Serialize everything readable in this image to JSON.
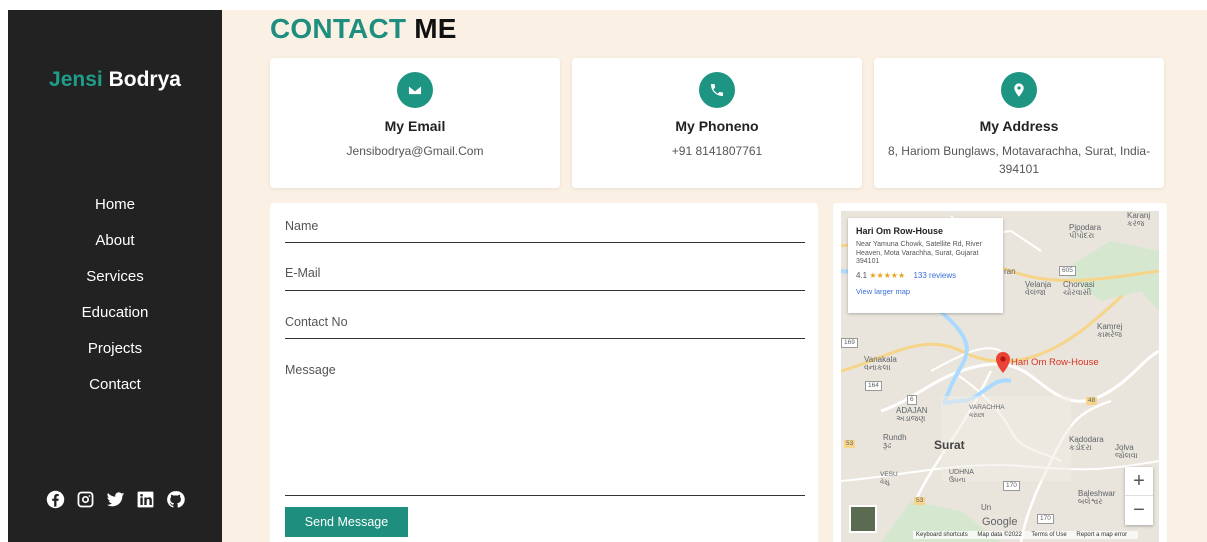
{
  "sidebar": {
    "brand_first": "Jensi",
    "brand_last": "Bodrya",
    "nav": [
      "Home",
      "About",
      "Services",
      "Education",
      "Projects",
      "Contact"
    ],
    "social_icons": [
      "facebook-icon",
      "instagram-icon",
      "twitter-icon",
      "linkedin-icon",
      "github-icon"
    ]
  },
  "main": {
    "title_a": "CONTACT",
    "title_b": "ME",
    "cards": [
      {
        "title": "My Email",
        "value": "Jensibodrya@Gmail.Com",
        "icon": "envelope-icon"
      },
      {
        "title": "My Phoneno",
        "value": "+91 8141807761",
        "icon": "phone-icon"
      },
      {
        "title": "My Address",
        "value": "8, Hariom Bunglaws, Motavarachha, Surat, India-394101",
        "icon": "map-marker-icon"
      }
    ],
    "form": {
      "name_placeholder": "Name",
      "email_placeholder": "E-Mail",
      "contact_placeholder": "Contact No",
      "message_placeholder": "Message",
      "submit_label": "Send Message"
    },
    "accent_color": "#1e8f7e",
    "sidebar_color": "#222222",
    "background_color": "#fbf0e4"
  },
  "map": {
    "place_name": "Hari Om Row-House",
    "address": "Near Yamuna Chowk, Satellite Rd, River Heaven, Mota Varachha, Surat, Gujarat 394101",
    "rating": "4.1",
    "stars": "★★★★★",
    "reviews": "133 reviews",
    "larger_map": "View larger map",
    "pin_label": "Hari Om Row-House",
    "city": "Surat",
    "labels": {
      "karanj": "Karanj",
      "karanj_gu": "કરંજ",
      "pipodara": "Pipodara",
      "pipodara_gu": "પીપોદરા",
      "velanja": "Velanja",
      "velanja_gu": "વેલંજા",
      "chorvasi": "Chorvasi",
      "chorvasi_gu": "ચોરવાસી",
      "kamrej": "Kamrej",
      "kamrej_gu": "કામરેજ",
      "vanakala": "Vanakala",
      "vanakala_gu": "વનાકલા",
      "varachha": "VARACHHA",
      "varachha_gu": "વરાછા",
      "adajan": "ADAJAN",
      "adajan_gu": "અડાજણ",
      "rundh": "Rundh",
      "rundh_gu": "રૂંઢ",
      "kadodara": "Kadodara",
      "kadodara_gu": "કડોદરા",
      "jolva": "Jolva",
      "jolva_gu": "જોલવા",
      "udhna": "UDHNA",
      "udhna_gu": "ઉધના",
      "vesu": "VESU",
      "vesu_gu": "વેસુ",
      "baleshwar": "Baleshwar",
      "baleshwar_gu": "બલેશ્વર",
      "ran": "ran",
      "un": "Un",
      "road_605": "605",
      "road_169": "169",
      "road_164": "164",
      "road_6": "6",
      "road_48": "48",
      "road_53a": "53",
      "road_53b": "53",
      "road_170a": "170",
      "road_170b": "170"
    },
    "zoom_in": "+",
    "zoom_out": "−",
    "google": "Google",
    "attribution": [
      "Keyboard shortcuts",
      "Map data ©2022",
      "Terms of Use",
      "Report a map error"
    ]
  }
}
